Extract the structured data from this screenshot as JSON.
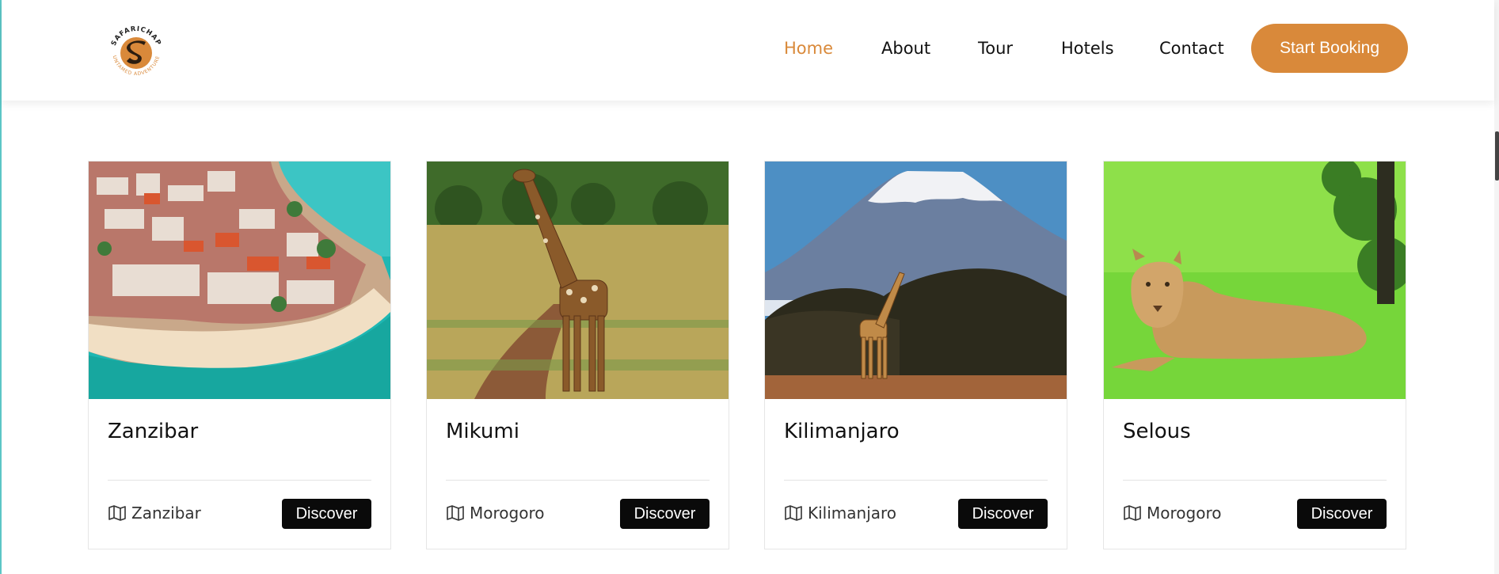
{
  "brand": {
    "name": "SAFARICHAP",
    "tagline": "UNTAMED ADVENTURE",
    "accent_color": "#d9893a"
  },
  "nav": {
    "items": [
      {
        "label": "Home",
        "active": true
      },
      {
        "label": "About",
        "active": false
      },
      {
        "label": "Tour",
        "active": false
      },
      {
        "label": "Hotels",
        "active": false
      },
      {
        "label": "Contact",
        "active": false
      }
    ],
    "cta_label": "Start Booking"
  },
  "destinations": [
    {
      "title": "Zanzibar",
      "location": "Zanzibar",
      "button": "Discover",
      "image": "aerial-island-town-beach"
    },
    {
      "title": "Mikumi",
      "location": "Morogoro",
      "button": "Discover",
      "image": "giraffe-savanna"
    },
    {
      "title": "Kilimanjaro",
      "location": "Kilimanjaro",
      "button": "Discover",
      "image": "mountain-giraffe-acacia"
    },
    {
      "title": "Selous",
      "location": "Morogoro",
      "button": "Discover",
      "image": "lioness-grass"
    }
  ],
  "icons": {
    "location": "map-icon"
  }
}
